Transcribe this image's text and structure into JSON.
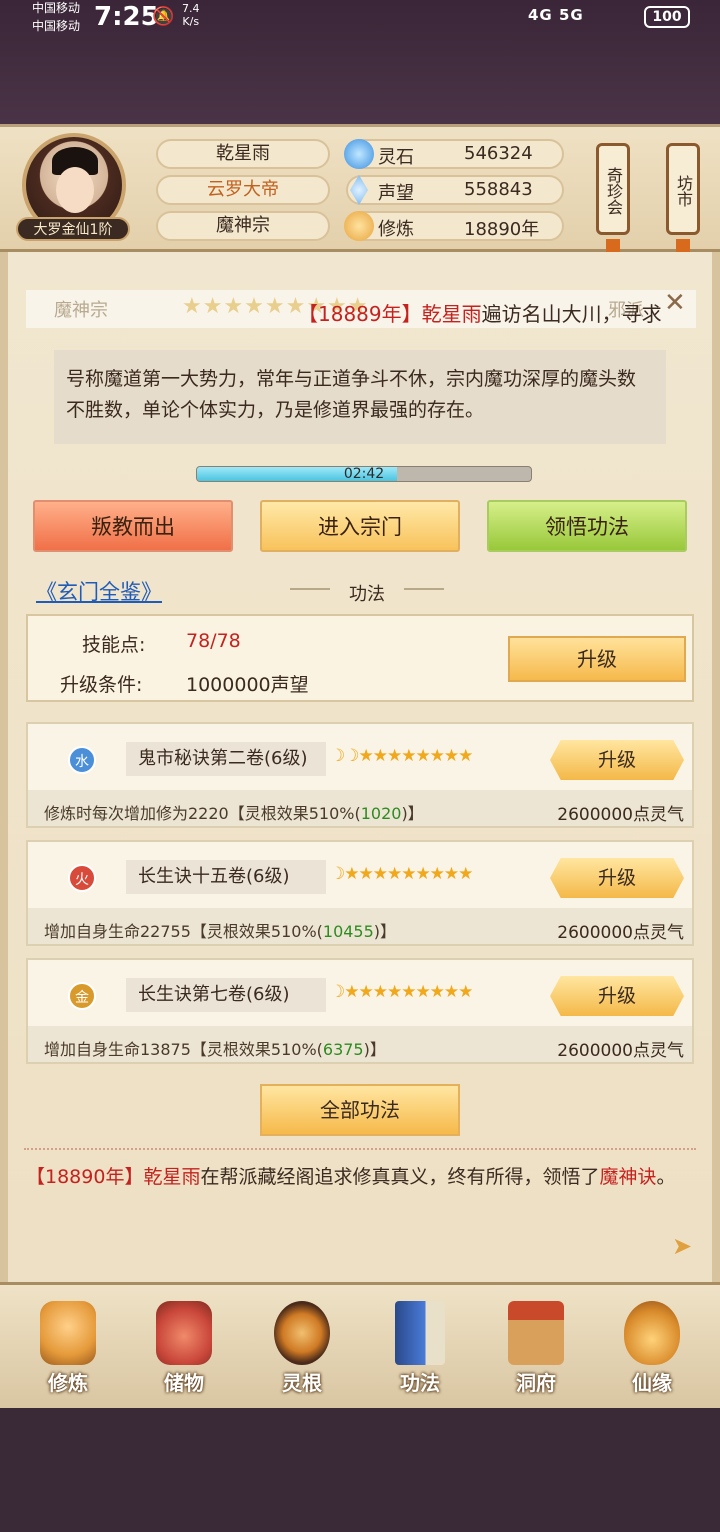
{
  "status_bar": {
    "carrier1": "中国移动",
    "carrier2": "中国移动",
    "time": "7:25",
    "speed_value": "7.4",
    "speed_unit": "K/s",
    "signals": "4G  5G",
    "battery": "100"
  },
  "header": {
    "rank": "大罗金仙1阶",
    "name": "乾星雨",
    "title": "云罗大帝",
    "sect": "魔神宗",
    "stats": [
      {
        "label": "灵石",
        "value": "546324",
        "icon": "gem-icon",
        "color": "#4aa8e8"
      },
      {
        "label": "声望",
        "value": "558843",
        "icon": "crystal-icon",
        "color": "#5fa6e8"
      },
      {
        "label": "修炼",
        "value": "18890年",
        "icon": "meditation-icon",
        "color": "#e7b04c"
      }
    ],
    "scroll_left": "奇珍会",
    "scroll_right": "坊市"
  },
  "ticker": {
    "faint_left": "魔神宗",
    "faint_right": "邪派",
    "stars": "★★★★★★★★★",
    "year": "【18889年】",
    "actor": "乾星雨",
    "text": "遍访名山大川，寻求"
  },
  "sect_description": "号称魔道第一大势力，常年与正道争斗不休，宗内魔功深厚的魔头数不胜数，单论个体实力，乃是修道界最强的存在。",
  "timer": {
    "text": "02:42",
    "fraction": 0.6
  },
  "actions": {
    "betray": "叛教而出",
    "enter": "进入宗门",
    "comprehend": "领悟功法"
  },
  "section": {
    "link": "《玄门全鉴》",
    "title": "功法"
  },
  "skill_points": {
    "label": "技能点:",
    "value": "78/78",
    "cond_label": "升级条件:",
    "cond_value": "1000000声望",
    "upgrade": "升级"
  },
  "skills": [
    {
      "element": "水",
      "element_color": "#4a8fd8",
      "name": "鬼市秘诀第二卷(6级)",
      "stars": "☽☽★★★★★★★★",
      "upgrade": "升级",
      "effect_prefix": "修炼时每次增加修为2220【灵根效果510%(",
      "effect_bonus": "1020",
      "effect_suffix": ")】",
      "cost": "2600000点灵气"
    },
    {
      "element": "火",
      "element_color": "#d84a3a",
      "name": "长生诀十五卷(6级)",
      "stars": "☽★★★★★★★★★",
      "upgrade": "升级",
      "effect_prefix": "增加自身生命22755【灵根效果510%(",
      "effect_bonus": "10455",
      "effect_suffix": ")】",
      "cost": "2600000点灵气"
    },
    {
      "element": "金",
      "element_color": "#d89a2a",
      "name": "长生诀第七卷(6级)",
      "stars": "☽★★★★★★★★★",
      "upgrade": "升级",
      "effect_prefix": "增加自身生命13875【灵根效果510%(",
      "effect_bonus": "6375",
      "effect_suffix": ")】",
      "cost": "2600000点灵气"
    }
  ],
  "all_skills": "全部功法",
  "log": {
    "year": "【18890年】",
    "actor": "乾星雨",
    "text": "在帮派藏经阁追求修真真义，终有所得，领悟了",
    "skill": "魔神诀",
    "end": "。"
  },
  "nav": [
    {
      "label": "修炼",
      "icon": "cultivate-icon",
      "color": "#e59a3a"
    },
    {
      "label": "储物",
      "icon": "storage-bag-icon",
      "color": "#c9463a"
    },
    {
      "label": "灵根",
      "icon": "spirit-root-icon",
      "color": "#b8541e"
    },
    {
      "label": "功法",
      "icon": "skill-book-icon",
      "color": "#3a6ab8"
    },
    {
      "label": "洞府",
      "icon": "cave-dwelling-icon",
      "color": "#b87a3a"
    },
    {
      "label": "仙缘",
      "icon": "gourd-icon",
      "color": "#d88a2a"
    }
  ]
}
